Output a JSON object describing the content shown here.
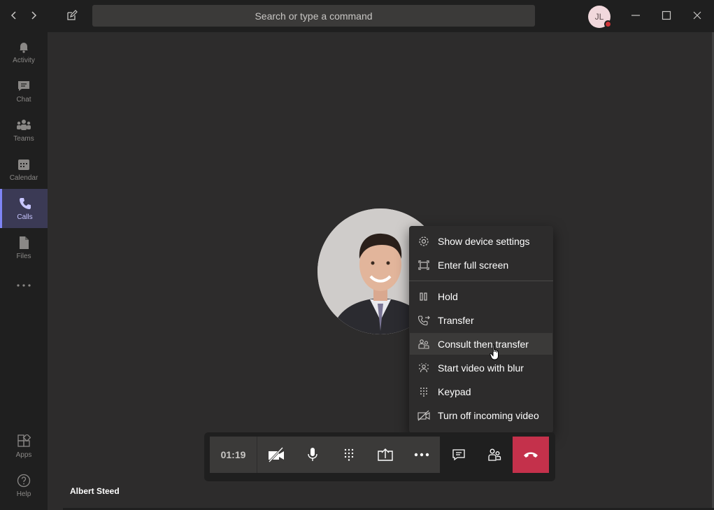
{
  "titlebar": {
    "search_placeholder": "Search or type a command",
    "user_initials": "JL",
    "presence_color": "#d13438"
  },
  "sidebar": {
    "items": [
      {
        "label": "Activity",
        "icon": "bell-icon"
      },
      {
        "label": "Chat",
        "icon": "chat-icon"
      },
      {
        "label": "Teams",
        "icon": "teams-icon"
      },
      {
        "label": "Calendar",
        "icon": "calendar-icon"
      },
      {
        "label": "Calls",
        "icon": "phone-icon",
        "active": true
      },
      {
        "label": "Files",
        "icon": "file-icon"
      },
      {
        "label": "",
        "icon": "more-icon"
      },
      {
        "label": "Apps",
        "icon": "apps-icon"
      },
      {
        "label": "Help",
        "icon": "help-icon"
      }
    ]
  },
  "menu": {
    "items": [
      {
        "label": "Show device settings",
        "icon": "gear-icon"
      },
      {
        "label": "Enter full screen",
        "icon": "fullscreen-icon"
      },
      {
        "label": "Hold",
        "icon": "pause-icon"
      },
      {
        "label": "Transfer",
        "icon": "transfer-icon"
      },
      {
        "label": "Consult then transfer",
        "icon": "consult-icon",
        "hovered": true
      },
      {
        "label": "Start video with blur",
        "icon": "blur-icon"
      },
      {
        "label": "Keypad",
        "icon": "keypad-icon"
      },
      {
        "label": "Turn off incoming video",
        "icon": "video-off-icon"
      }
    ]
  },
  "call": {
    "timer": "01:19",
    "caller_name": "Albert Steed",
    "hangup_color": "#c4314b",
    "accent_color": "#7f85f5"
  }
}
